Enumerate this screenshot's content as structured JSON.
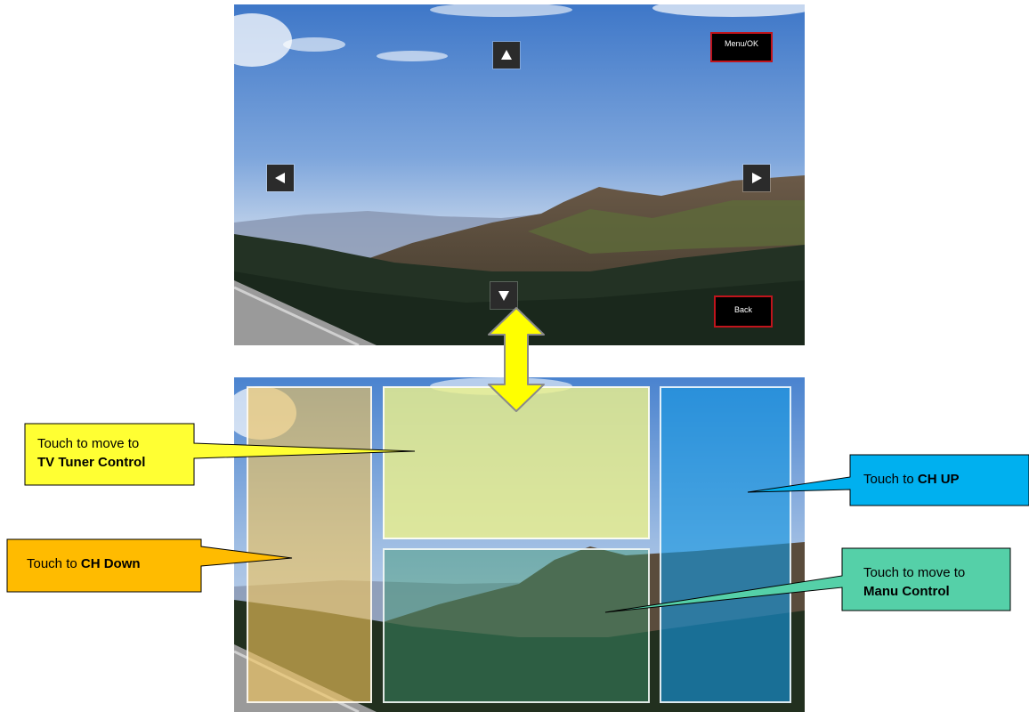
{
  "top_screen": {
    "menu_ok_label": "Menu/OK",
    "back_label": "Back",
    "arrows": {
      "up": "up-arrow",
      "down": "down-arrow",
      "left": "left-arrow",
      "right": "right-arrow"
    }
  },
  "callouts": {
    "tv_tuner": {
      "line1": "Touch to move to",
      "line2": "TV Tuner Control",
      "color": "#ffff33"
    },
    "ch_down": {
      "prefix": "Touch to ",
      "bold": "CH Down",
      "color": "#ffbb00"
    },
    "ch_up": {
      "prefix": "Touch to ",
      "bold": "CH UP",
      "color": "#00b0ef"
    },
    "menu": {
      "line1": "Touch to move to",
      "line2": "Manu Control",
      "color": "#55d0a8"
    }
  },
  "colors": {
    "button_border": "#c0141c",
    "double_arrow_fill": "#ffff00",
    "double_arrow_stroke": "#8a8a8a"
  }
}
